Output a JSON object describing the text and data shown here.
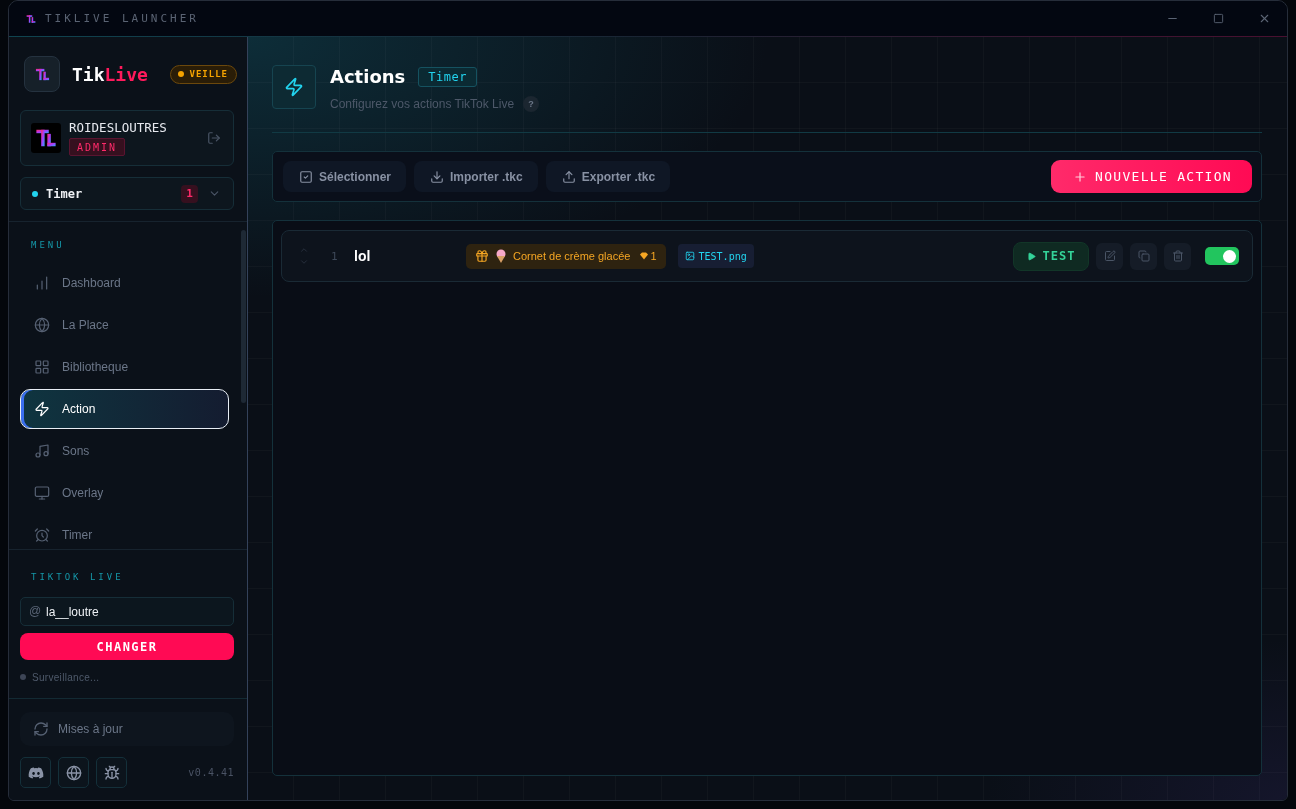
{
  "window": {
    "title": "TIKLIVE LAUNCHER"
  },
  "sidebar": {
    "brand": {
      "first": "Tik",
      "second": "Live"
    },
    "status_badge": "VEILLE",
    "user": {
      "name": "ROIDESLOUTRES",
      "role": "ADMIN"
    },
    "profile_select": {
      "label": "Timer",
      "count": "1"
    },
    "menu_title": "MENU",
    "menu": [
      {
        "label": "Dashboard",
        "selected": false
      },
      {
        "label": "La Place",
        "selected": false
      },
      {
        "label": "Bibliotheque",
        "selected": false
      },
      {
        "label": "Action",
        "selected": true
      },
      {
        "label": "Sons",
        "selected": false
      },
      {
        "label": "Overlay",
        "selected": false
      },
      {
        "label": "Timer",
        "selected": false
      }
    ],
    "live_title": "TIKTOK LIVE",
    "username_field": {
      "prefix": "@",
      "value": "la__loutre"
    },
    "change_button": "CHANGER",
    "monitor_status": {
      "label": "Surveillance...",
      "connected": false
    },
    "updates_button": "Mises à jour",
    "version": "v0.4.41"
  },
  "main": {
    "title": "Actions",
    "profile_badge": "Timer",
    "subtitle": "Configurez vos actions TikTok Live",
    "help": "?",
    "toolbar_buttons": [
      "Sélectionner",
      "Importer .tkc",
      "Exporter .tkc"
    ],
    "new_action_button": "NOUVELLE ACTION",
    "actions": [
      {
        "number": "1",
        "name": "lol",
        "gift": "Cornet de crème glacée",
        "gift_cost": "1",
        "media": "TEST.png",
        "test_button": "TEST",
        "enabled": true
      }
    ]
  }
}
